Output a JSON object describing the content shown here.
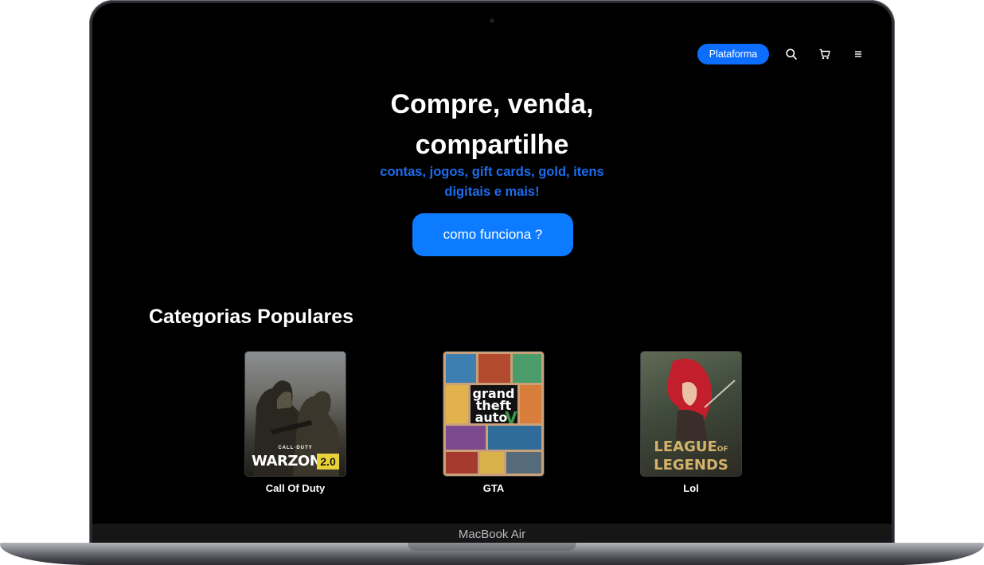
{
  "device": {
    "label": "MacBook Air"
  },
  "nav": {
    "platform_label": "Plataforma",
    "icons": [
      "search-icon",
      "cart-icon",
      "menu-icon"
    ]
  },
  "hero": {
    "title_line1": "Compre, venda,",
    "title_line2": "compartilhe",
    "subtitle": "contas, jogos, gift cards, gold, itens digitais e mais!",
    "cta_label": "como funciona ?"
  },
  "categories": {
    "title": "Categorias Populares",
    "items": [
      {
        "name": "Call Of Duty",
        "cover_text_top": "CALL·DUTY",
        "cover_text": "WARZONE",
        "cover_badge": "2.0"
      },
      {
        "name": "GTA",
        "cover_text": "grand theft auto"
      },
      {
        "name": "Lol",
        "cover_text_1": "LEAGUE",
        "cover_text_of": "OF",
        "cover_text_2": "LEGENDS"
      }
    ]
  },
  "colors": {
    "accent": "#0d6efd",
    "subtitle": "#1a6df0",
    "background": "#000000"
  }
}
